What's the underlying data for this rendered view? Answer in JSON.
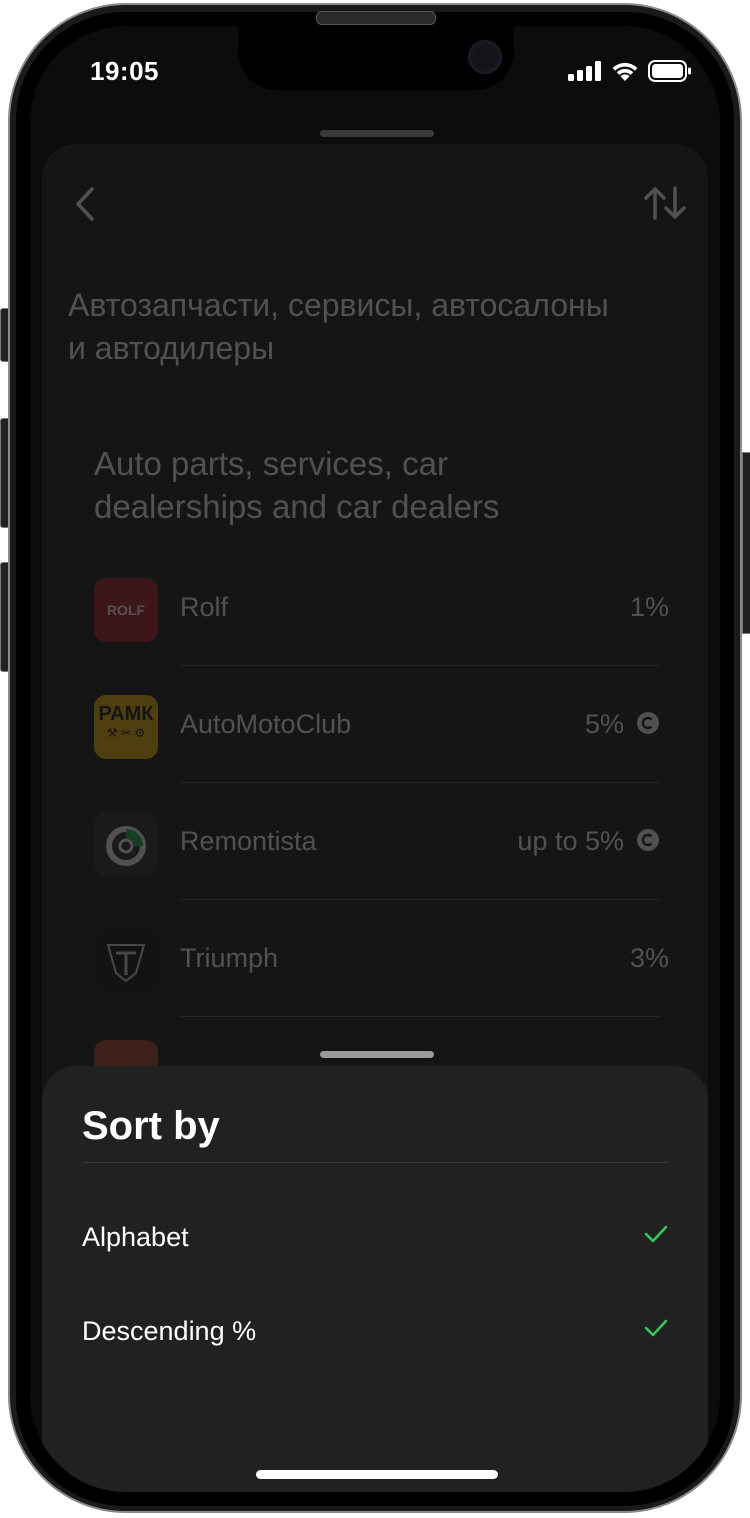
{
  "status_bar": {
    "time": "19:05"
  },
  "header": {
    "back_icon": "chevron-left-icon",
    "sort_icon": "sort-arrows-icon"
  },
  "page": {
    "title": "Автозапчасти, сервисы, автосалоны и автодилеры",
    "section_title": "Auto parts, services, car dealerships and car dealers"
  },
  "partners": [
    {
      "name": "Rolf",
      "percent": "1%",
      "logo_text": "ROLF",
      "logo_color": "#b31b2b"
    },
    {
      "name": "AutoMotoClub",
      "percent": "5%",
      "logo_text": "РАМК",
      "logo_color": "#f2b705"
    },
    {
      "name": "Remontista",
      "percent": "up to 5%",
      "logo_color": "#2c2c2c"
    },
    {
      "name": "Triumph",
      "percent": "3%",
      "logo_color": "#111111"
    }
  ],
  "sort_sheet": {
    "title": "Sort by",
    "options": [
      {
        "label": "Alphabet",
        "selected": true
      },
      {
        "label": "Descending %",
        "selected": true
      }
    ],
    "check_color": "#34c759"
  }
}
